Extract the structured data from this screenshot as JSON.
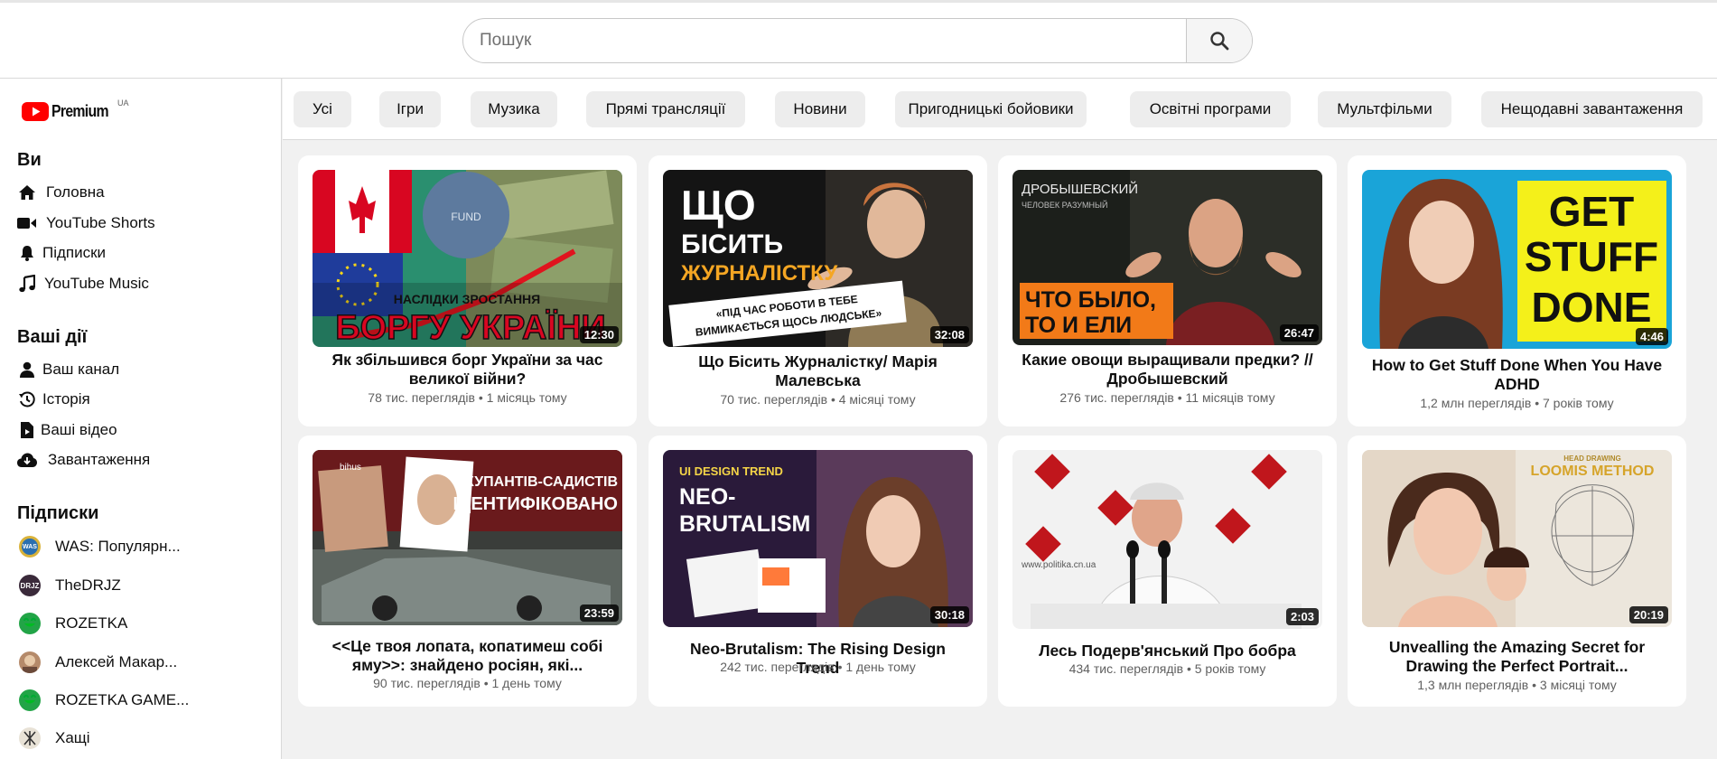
{
  "search": {
    "placeholder": "Пошук"
  },
  "logo": {
    "text": "Premium",
    "region": "UA"
  },
  "sidebar": {
    "you_title": "Ви",
    "you_items": [
      {
        "label": "Головна",
        "icon": "home-icon"
      },
      {
        "label": "YouTube Shorts",
        "icon": "shorts-icon"
      },
      {
        "label": "Підписки",
        "icon": "bell-icon"
      },
      {
        "label": "YouTube Music",
        "icon": "music-note-icon"
      }
    ],
    "activity_title": "Ваші дії",
    "activity_items": [
      {
        "label": "Ваш канал",
        "icon": "user-icon"
      },
      {
        "label": "Історія",
        "icon": "history-icon"
      },
      {
        "label": "Ваші відео",
        "icon": "file-video-icon"
      },
      {
        "label": "Завантаження",
        "icon": "cloud-download-icon"
      }
    ],
    "subs_title": "Підписки",
    "subs": [
      {
        "label": "WAS: Популярн...",
        "avatar_color": "#2a6fb0"
      },
      {
        "label": "TheDRJZ",
        "avatar_color": "#3a2a3a"
      },
      {
        "label": "ROZETKA",
        "avatar_color": "#22a447"
      },
      {
        "label": "Алексей Макар...",
        "avatar_color": "#b58a6a"
      },
      {
        "label": "ROZETKA GAME...",
        "avatar_color": "#22a447"
      },
      {
        "label": "Хащі",
        "avatar_color": "#e8e2d6"
      }
    ]
  },
  "chips": [
    "Усі",
    "Ігри",
    "Музика",
    "Прямі трансляції",
    "Новини",
    "Пригодницькі бойовики",
    "Освітні програми",
    "Мультфільми",
    "Нещодавні завантаження"
  ],
  "videos": [
    {
      "title": "Як збільшився борг України за час великої війни?",
      "meta": "78 тис. переглядів • 1 місяць тому",
      "duration": "12:30",
      "thumb_text": [
        "НАСЛІДКИ ЗРОСТАННЯ",
        "БОРГУ УКРАЇНИ"
      ]
    },
    {
      "title": "Що Бісить Журналістку/ Марія Малевська",
      "meta": "70 тис. переглядів • 4 місяці тому",
      "duration": "32:08",
      "thumb_text": [
        "ЩО",
        "БІСИТЬ",
        "ЖУРНАЛІСТКУ",
        "«ПІД ЧАС РОБОТИ В ТЕБЕ",
        "ВИМИКАЄТЬСЯ ЩОСЬ ЛЮДСЬКЕ»"
      ]
    },
    {
      "title": "Какие овощи выращивали предки? // Дробышевский",
      "meta": "276 тис. переглядів • 11 місяців тому",
      "duration": "26:47",
      "thumb_text": [
        "ДРОБЫШЕВСКИЙ",
        "ЧЕЛОВЕК РАЗУМНЫЙ",
        "ЧТО БЫЛО,",
        "ТО И ЕЛИ"
      ]
    },
    {
      "title": "How to Get Stuff Done When You Have ADHD",
      "meta": "1,2 млн переглядів • 7 років тому",
      "duration": "4:46",
      "thumb_text": [
        "GET",
        "STUFF",
        "DONE"
      ]
    },
    {
      "title": "<<Це твоя лопата, копатимеш собі яму>>: знайдено росіян, які...",
      "meta": "90 тис. переглядів • 1 день тому",
      "duration": "23:59",
      "thumb_text": [
        "bihus",
        "ОКУПАНТІВ-САДИСТІВ",
        "ІДЕНТИФІКОВАНО"
      ]
    },
    {
      "title": "Neo-Brutalism: The Rising Design Trend",
      "meta": "242 тис. переглядів • 1 день тому",
      "duration": "30:18",
      "thumb_text": [
        "UI DESIGN TREND",
        "NEO-",
        "BRUTALISM"
      ]
    },
    {
      "title": "Лесь Подерв'янський Про бобра",
      "meta": "434 тис. переглядів • 5 років тому",
      "duration": "2:03",
      "thumb_text": [
        "www.politika.cn.ua"
      ]
    },
    {
      "title": "Unvealling the Amazing Secret for Drawing the Perfect Portrait...",
      "meta": "1,3 млн переглядів • 3 місяці тому",
      "duration": "20:19",
      "thumb_text": [
        "HEAD DRAWING",
        "LOOMIS METHOD"
      ]
    }
  ]
}
